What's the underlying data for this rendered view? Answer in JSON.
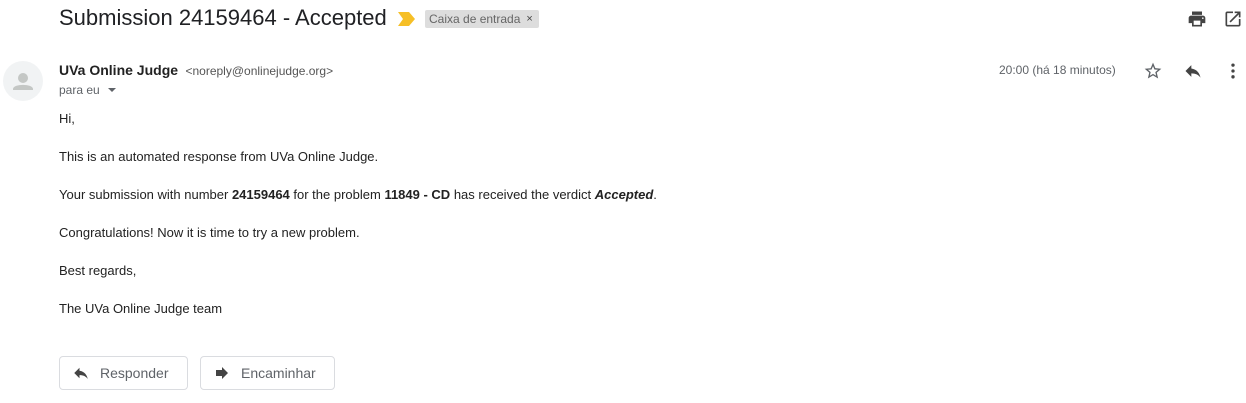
{
  "email": {
    "subject": "Submission 24159464 - Accepted",
    "label": "Caixa de entrada",
    "label_remove": "×",
    "sender_name": "UVa Online Judge",
    "sender_email": "<noreply@onlinejudge.org>",
    "to": "para eu",
    "date": "20:00 (há 18 minutos)"
  },
  "body": {
    "greeting": "Hi,",
    "line1": "This is an automated response from UVa Online Judge.",
    "line2_a": "Your submission with number ",
    "line2_num": "24159464",
    "line2_b": " for the problem ",
    "line2_problem": "11849 - CD",
    "line2_c": " has received the verdict ",
    "line2_verdict": "Accepted",
    "line2_d": ".",
    "line3": "Congratulations! Now it is time to try a new problem.",
    "line4": "Best regards,",
    "line5": "The UVa Online Judge team"
  },
  "actions": {
    "reply": "Responder",
    "forward": "Encaminhar"
  },
  "icons": {
    "print": "print-icon",
    "open_new_window": "open-in-new-window-icon",
    "star": "star-icon",
    "reply": "reply-icon",
    "more": "more-vertical-icon",
    "importance": "importance-marker-icon",
    "avatar": "person-avatar-icon"
  },
  "colors": {
    "importance": "#f6bf26",
    "label_chip": "#dddddd"
  }
}
